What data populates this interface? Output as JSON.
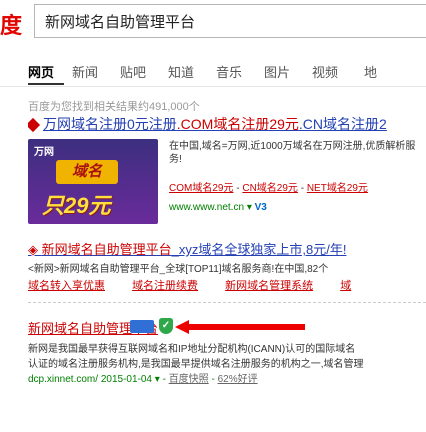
{
  "logo_fragment": "度",
  "search": {
    "value": "新网域名自助管理平台"
  },
  "tabs": [
    "网页",
    "新闻",
    "贴吧",
    "知道",
    "音乐",
    "图片",
    "视频",
    "地"
  ],
  "result_count": "百度为您找到相关结果约491,000个",
  "result1": {
    "title_prefix": "万网域名注册0元注册",
    "title_mid": ".COM域名注册29元",
    "title_tail": ".CN域名注册2",
    "promo_brand": "万网",
    "promo_badge": "域名",
    "promo_price": "只29元",
    "desc": "在中国,域名=万网,近1000万域名在万网注册,优质解析服务!",
    "links": [
      "COM域名29元",
      "CN域名29元",
      "NET域名29元"
    ],
    "url": "www.www.net.cn",
    "v_label": "V3"
  },
  "result2": {
    "title_a": "新网域名自助管理平台",
    "title_b": "_xyz域名全球独家上市,8元/年!",
    "desc": "<新网>新网域名自助管理平台_全球[TOP11]域名服务商!在中国,82个",
    "sublinks": [
      "域名转入享优惠",
      "域名注册续费",
      "新网域名管理系统",
      "域"
    ]
  },
  "result3": {
    "title": "新网域名自助管理平台",
    "desc_line1": "新网是我国最早获得互联网域名和IP地址分配机构(ICANN)认可的国际域名",
    "desc_line2": "认证的域名注册服务机构,是我国最早提供域名注册服务的机构之一,域名管理",
    "url": "dcp.xinnet.com/",
    "date": "2015-01-04",
    "snapshot": "百度快照",
    "score": "62%好评"
  }
}
